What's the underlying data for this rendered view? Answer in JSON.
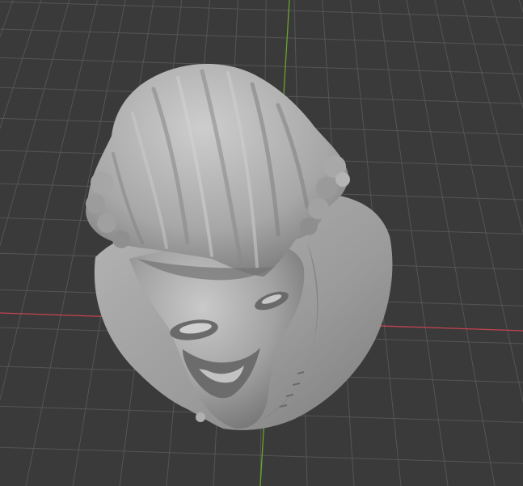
{
  "viewport": {
    "background": "#3a3a3a",
    "grid_color": "#555555",
    "x_axis_color": "#c4434f",
    "y_axis_color": "#6aa32a"
  },
  "model": {
    "icon": "sculpted-bust-mesh",
    "base_color": "#9a9a9a",
    "highlight_color": "#c8c8c8",
    "shadow_color": "#5e5e5e"
  }
}
